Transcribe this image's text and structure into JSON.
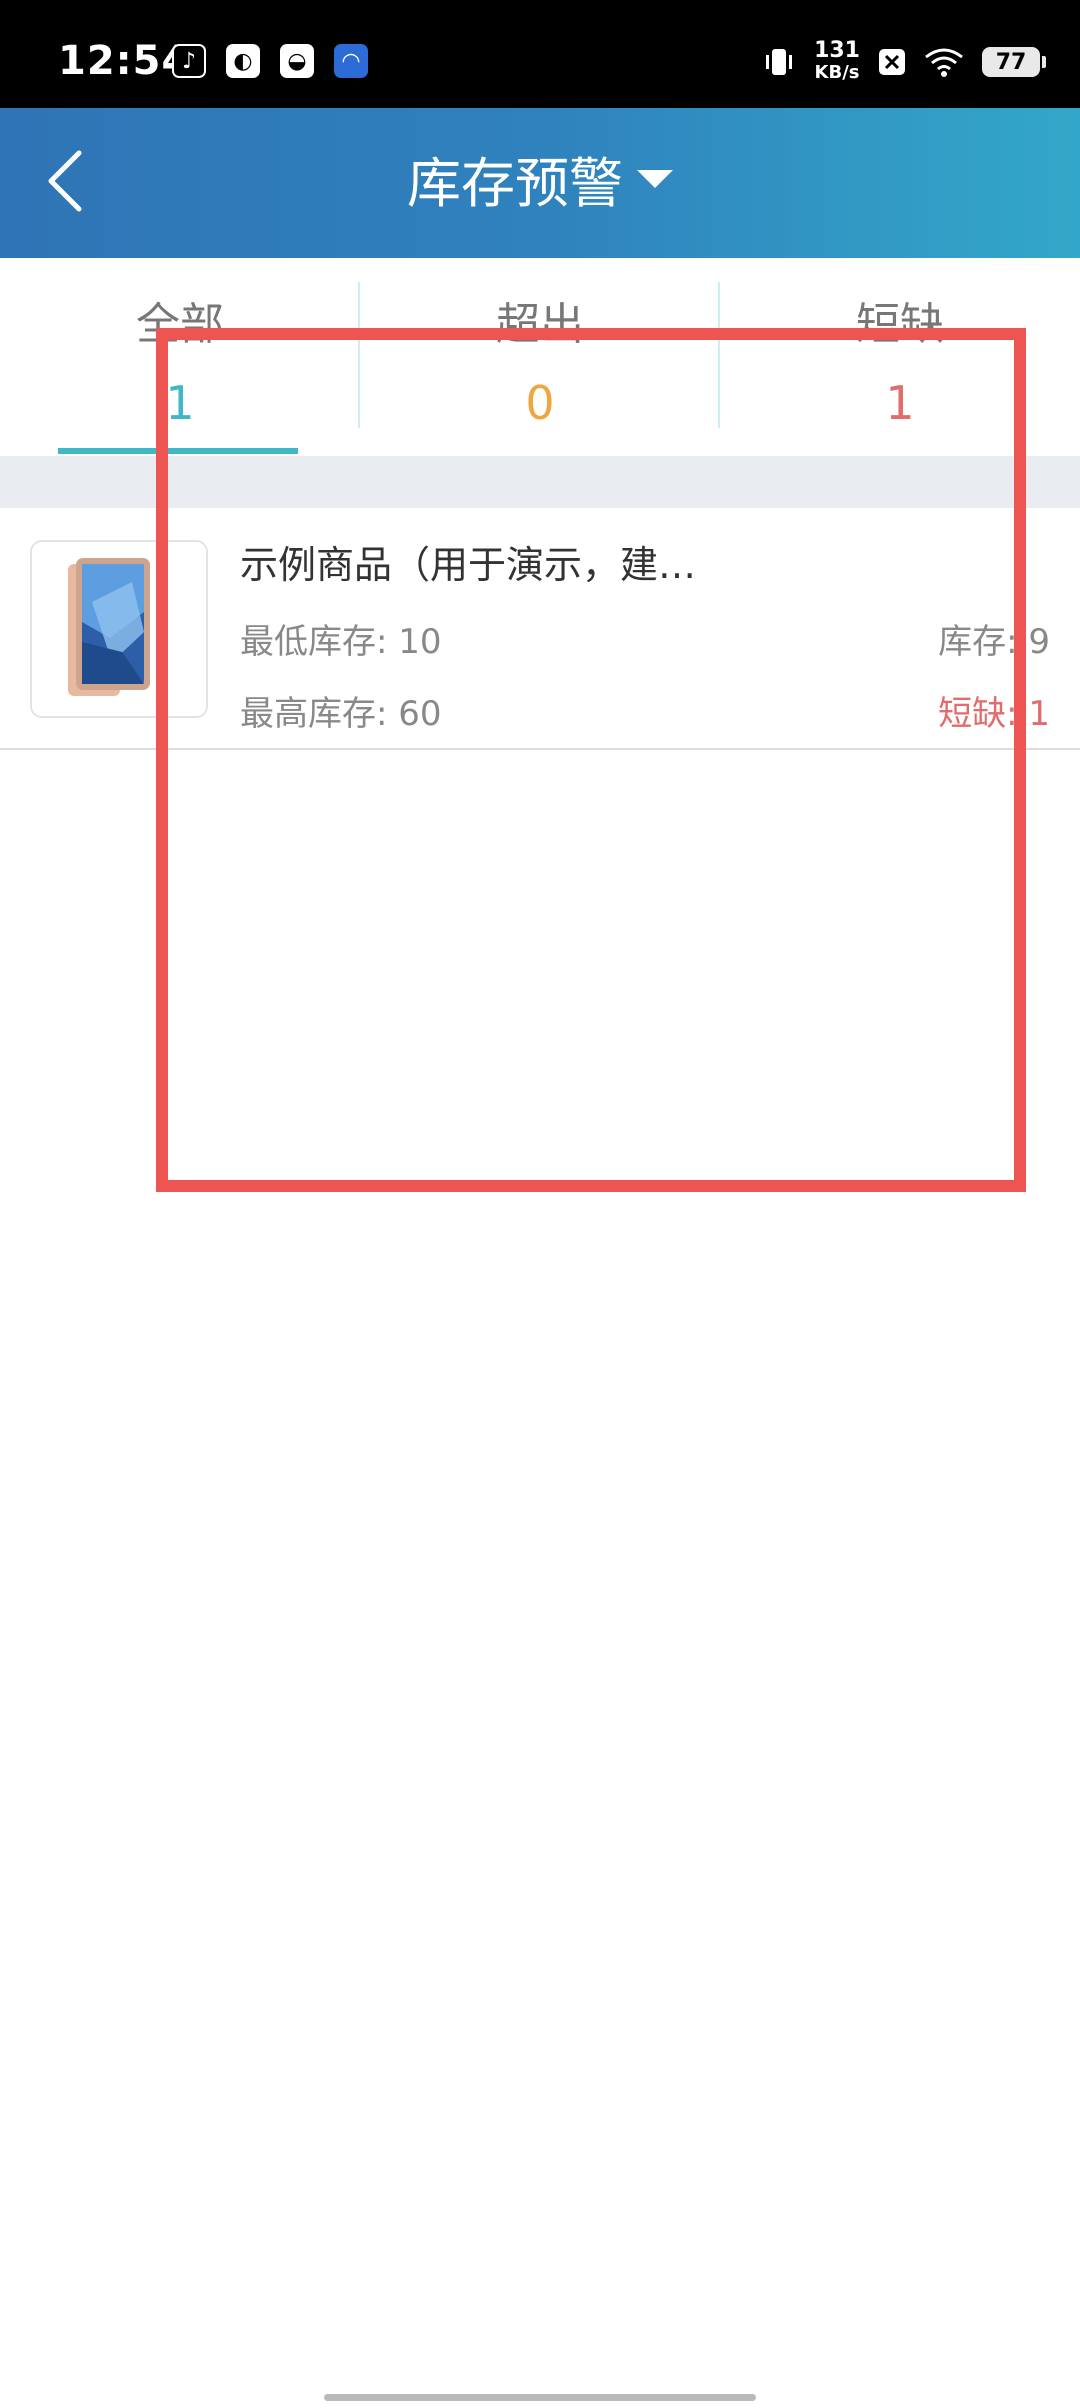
{
  "status_bar": {
    "time": "12:54",
    "net_speed_value": "131",
    "net_speed_unit": "KB/s",
    "battery": "77"
  },
  "header": {
    "title": "库存预警"
  },
  "tabs": [
    {
      "label": "全部",
      "count": "1",
      "color": "#3fb8c6"
    },
    {
      "label": "超出",
      "count": "0",
      "color": "#f0a640"
    },
    {
      "label": "短缺",
      "count": "1",
      "color": "#e26c6c"
    }
  ],
  "item": {
    "title": "示例商品（用于演示，建…",
    "min_stock_label": "最低库存: 10",
    "max_stock_label": "最高库存: 60",
    "stock_label": "库存: 9",
    "shortage_label": "短缺: 1"
  },
  "colors": {
    "header_start": "#2f74b6",
    "header_end": "#33a7c9",
    "accent": "#3fb8c6",
    "warning": "#f0a640",
    "danger": "#e26c6c",
    "highlight": "#ee5552"
  }
}
